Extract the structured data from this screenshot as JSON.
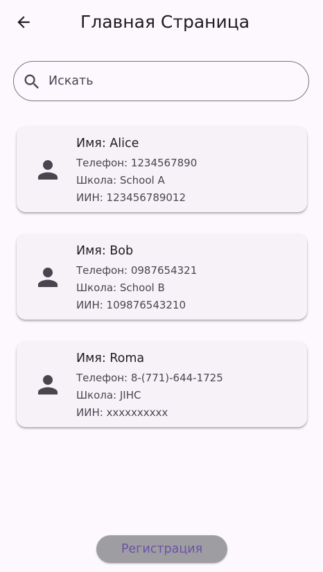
{
  "appbar": {
    "title": "Главная Страница",
    "back_icon": "arrow-back-icon"
  },
  "search": {
    "placeholder": "Искать",
    "value": "",
    "icon": "search-icon"
  },
  "students": [
    {
      "name": "Имя: Alice",
      "phone": "Телефон: 1234567890",
      "school": "Школа: School A",
      "iin": "ИИН: 123456789012"
    },
    {
      "name": "Имя: Bob",
      "phone": "Телефон: 0987654321",
      "school": "Школа: School B",
      "iin": "ИИН: 109876543210"
    },
    {
      "name": "Имя: Roma",
      "phone": "Телефон: 8-(771)-644-1725",
      "school": "Школа: JIHC",
      "iin": "ИИН: xxxxxxxxxx"
    }
  ],
  "register_button": {
    "label": "Регистрация"
  },
  "colors": {
    "background": "#fdf7fe",
    "card": "#f7f2f8",
    "icon": "#49454f",
    "button_bg": "#9e9ea2",
    "button_text": "#6b52a6"
  }
}
